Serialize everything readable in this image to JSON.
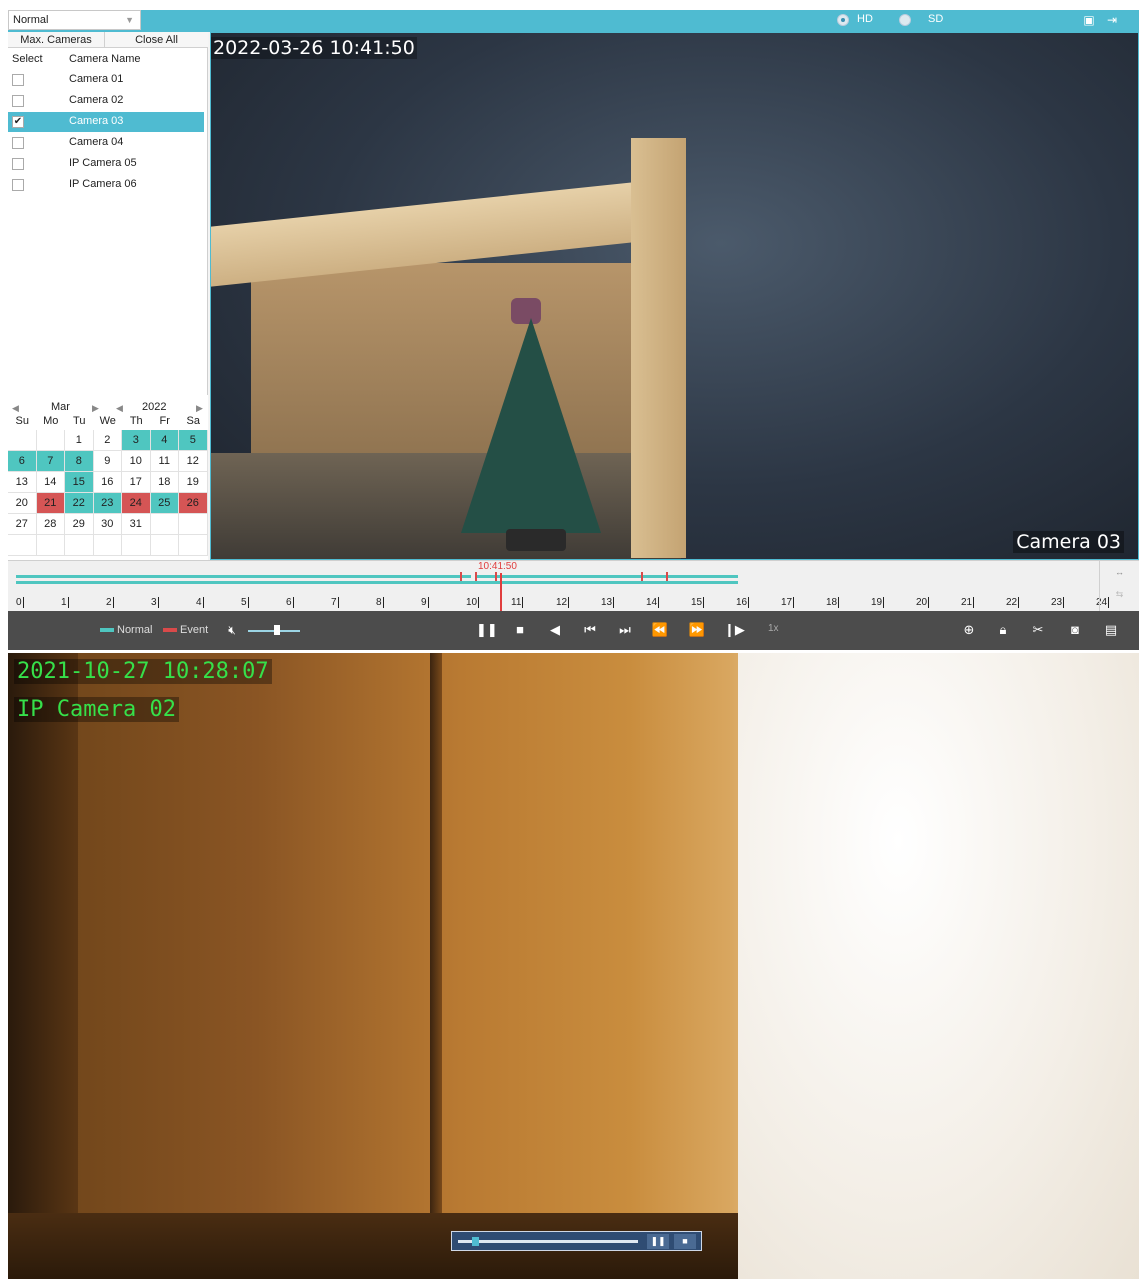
{
  "mode_select": {
    "value": "Normal"
  },
  "quality": {
    "hd": "HD",
    "sd": "SD",
    "selected": "HD"
  },
  "left_panel": {
    "max_cameras": "Max. Cameras",
    "close_all": "Close All",
    "col_select": "Select",
    "col_name": "Camera Name",
    "cameras": [
      {
        "name": "Camera 01",
        "checked": false
      },
      {
        "name": "Camera 02",
        "checked": false
      },
      {
        "name": "Camera 03",
        "checked": true
      },
      {
        "name": "Camera 04",
        "checked": false
      },
      {
        "name": "IP Camera 05",
        "checked": false
      },
      {
        "name": "IP Camera 06",
        "checked": false
      }
    ]
  },
  "calendar": {
    "month": "Mar",
    "year": "2022",
    "weekdays": [
      "Su",
      "Mo",
      "Tu",
      "We",
      "Th",
      "Fr",
      "Sa"
    ],
    "days": [
      {
        "d": "",
        "t": ""
      },
      {
        "d": "",
        "t": ""
      },
      {
        "d": "1",
        "t": ""
      },
      {
        "d": "2",
        "t": ""
      },
      {
        "d": "3",
        "t": "n"
      },
      {
        "d": "4",
        "t": "n"
      },
      {
        "d": "5",
        "t": "n"
      },
      {
        "d": "6",
        "t": "n"
      },
      {
        "d": "7",
        "t": "n"
      },
      {
        "d": "8",
        "t": "n"
      },
      {
        "d": "9",
        "t": ""
      },
      {
        "d": "10",
        "t": ""
      },
      {
        "d": "11",
        "t": ""
      },
      {
        "d": "12",
        "t": ""
      },
      {
        "d": "13",
        "t": ""
      },
      {
        "d": "14",
        "t": ""
      },
      {
        "d": "15",
        "t": "n"
      },
      {
        "d": "16",
        "t": ""
      },
      {
        "d": "17",
        "t": ""
      },
      {
        "d": "18",
        "t": ""
      },
      {
        "d": "19",
        "t": ""
      },
      {
        "d": "20",
        "t": ""
      },
      {
        "d": "21",
        "t": "e"
      },
      {
        "d": "22",
        "t": "n"
      },
      {
        "d": "23",
        "t": "n"
      },
      {
        "d": "24",
        "t": "e"
      },
      {
        "d": "25",
        "t": "n"
      },
      {
        "d": "26",
        "t": "e"
      },
      {
        "d": "27",
        "t": ""
      },
      {
        "d": "28",
        "t": ""
      },
      {
        "d": "29",
        "t": ""
      },
      {
        "d": "30",
        "t": ""
      },
      {
        "d": "31",
        "t": ""
      },
      {
        "d": "",
        "t": ""
      },
      {
        "d": "",
        "t": ""
      },
      {
        "d": "",
        "t": ""
      },
      {
        "d": "",
        "t": ""
      },
      {
        "d": "",
        "t": ""
      },
      {
        "d": "",
        "t": ""
      },
      {
        "d": "",
        "t": ""
      },
      {
        "d": "",
        "t": ""
      },
      {
        "d": "",
        "t": ""
      }
    ]
  },
  "main_video": {
    "timestamp": "2022-03-26 10:41:50",
    "camera_label": "Camera 03"
  },
  "timeline": {
    "cursor_time": "10:41:50",
    "hours": [
      "0",
      "1",
      "2",
      "3",
      "4",
      "5",
      "6",
      "7",
      "8",
      "9",
      "10",
      "11",
      "12",
      "13",
      "14",
      "15",
      "16",
      "17",
      "18",
      "19",
      "20",
      "21",
      "22",
      "23",
      "24"
    ]
  },
  "controls": {
    "legend_normal": "Normal",
    "legend_event": "Event",
    "speed": "1x",
    "volume_level": 0.55
  },
  "colors": {
    "accent": "#4fbbd1",
    "normal": "#4fc6c0",
    "event": "#d55555",
    "osd_green": "#36e04a"
  },
  "second_video": {
    "timestamp": "2021-10-27 10:28:07",
    "camera_label": "IP Camera 02",
    "progress": 0.08
  }
}
